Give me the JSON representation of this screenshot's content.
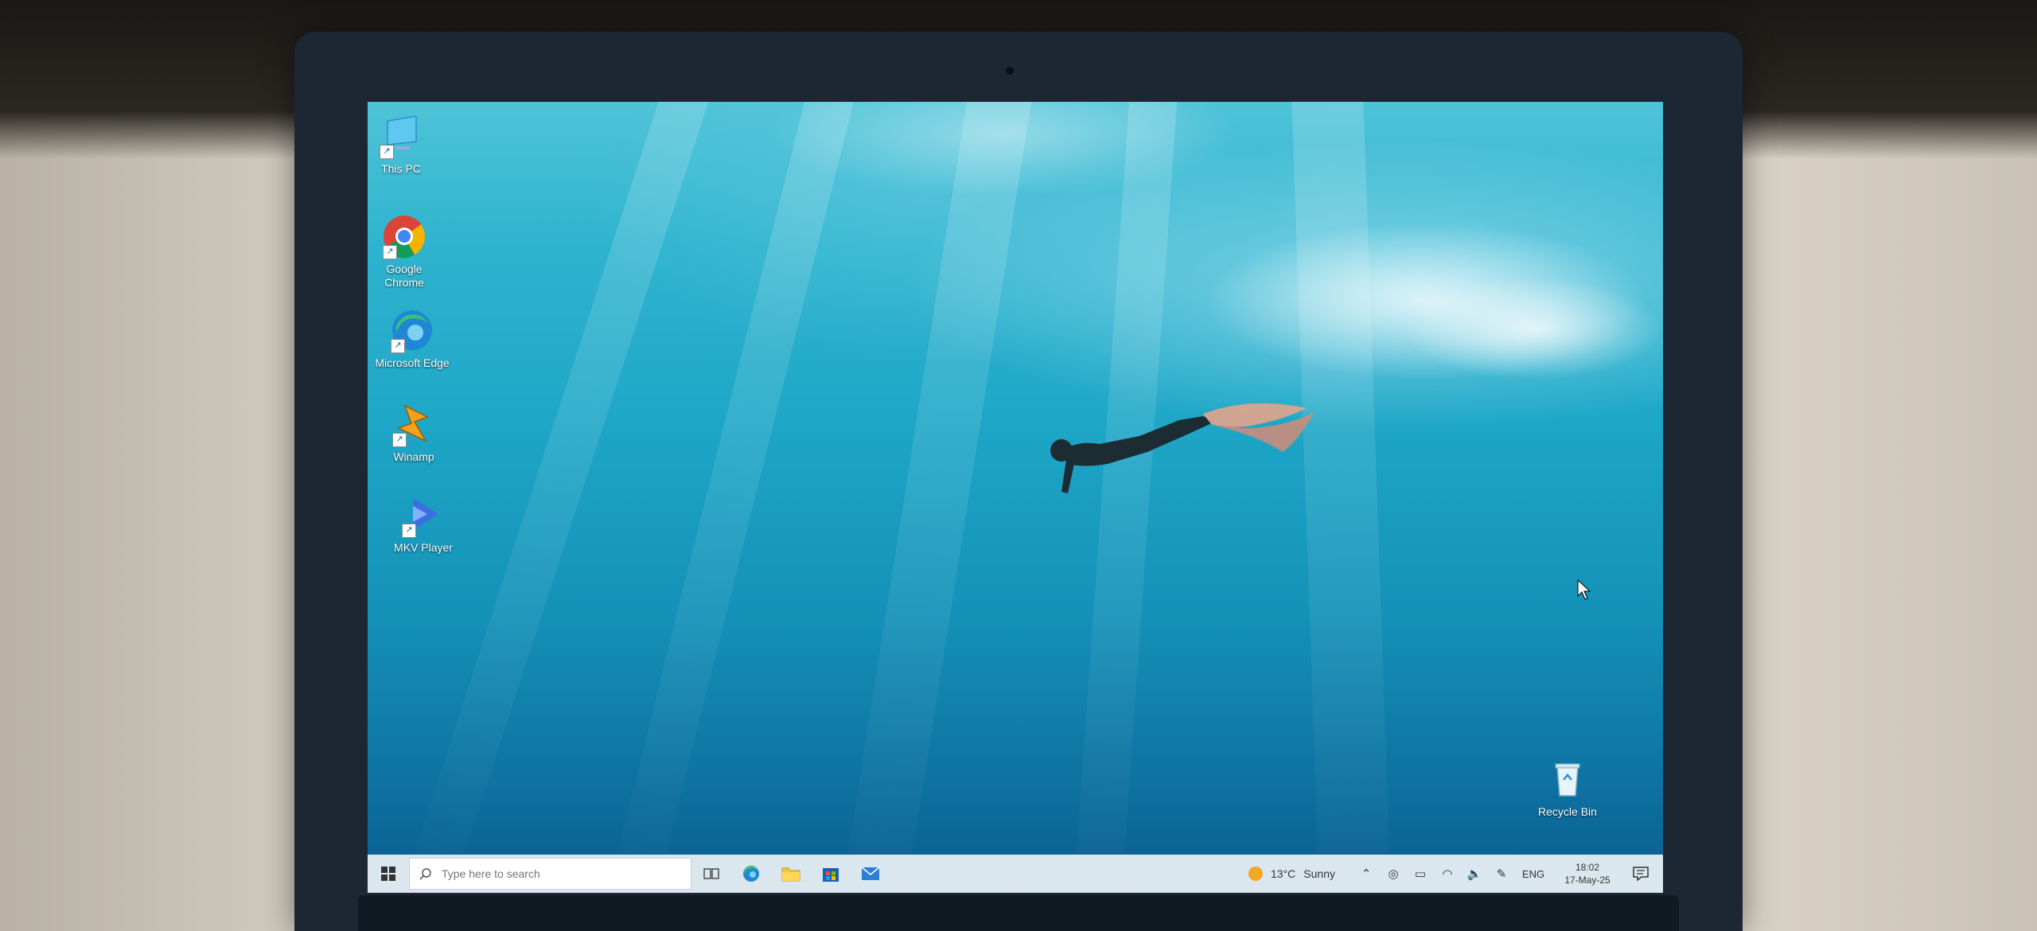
{
  "desktop": {
    "icons": [
      {
        "label": "This PC",
        "icon": "this-pc-icon"
      },
      {
        "label": "Google Chrome",
        "icon": "chrome-icon"
      },
      {
        "label": "Microsoft Edge",
        "icon": "edge-icon"
      },
      {
        "label": "Winamp",
        "icon": "winamp-icon"
      },
      {
        "label": "MKV Player",
        "icon": "mkv-player-icon"
      },
      {
        "label": "Recycle Bin",
        "icon": "recycle-bin-icon"
      }
    ]
  },
  "taskbar": {
    "search_placeholder": "Type here to search",
    "pinned": [
      "task-view-icon",
      "edge-icon",
      "file-explorer-icon",
      "store-icon",
      "mail-icon"
    ],
    "weather": {
      "temp": "13°C",
      "condition": "Sunny"
    },
    "language": "ENG",
    "time": "18:02",
    "date": "17-May-25"
  },
  "colors": {
    "taskbar_bg": "#e4ecf2",
    "water_top": "#4fc3d8",
    "water_bottom": "#0b5c8e"
  }
}
